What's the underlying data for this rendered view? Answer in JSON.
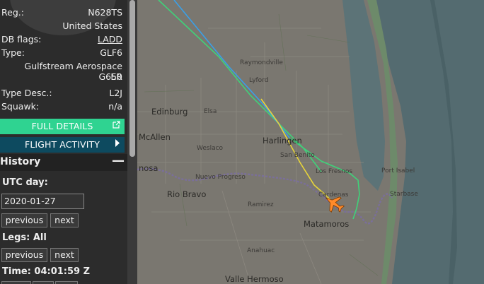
{
  "aircraft": {
    "reg_label": "Reg.:",
    "reg_value": "N628TS",
    "country": "United States",
    "dbflags_label": "DB flags:",
    "dbflags_value": "LADD",
    "type_label": "Type:",
    "type_value": "GLF6",
    "type_name_line1": "Gulfstream Aerospace G650",
    "type_name_line2": "ER",
    "typedesc_label": "Type Desc.:",
    "typedesc_value": "L2J",
    "squawk_label": "Squawk:",
    "squawk_value": "n/a"
  },
  "buttons": {
    "full_details": "FULL DETAILS",
    "flight_activity": "FLIGHT ACTIVITY"
  },
  "history": {
    "title": "History",
    "utc_day_label": "UTC day:",
    "date_value": "2020-01-27",
    "previous_label": "previous",
    "next_label": "next",
    "legs_label": "Legs: All",
    "time_label": "Time: 04:01:59 Z"
  },
  "map": {
    "places": [
      {
        "name": "Raymondville"
      },
      {
        "name": "Lyford"
      },
      {
        "name": "Edinburg"
      },
      {
        "name": "Elsa"
      },
      {
        "name": "McAllen"
      },
      {
        "name": "Weslaco"
      },
      {
        "name": "Harlingen"
      },
      {
        "name": "San Benito"
      },
      {
        "name": "Los Fresnos"
      },
      {
        "name": "Port Isabel"
      },
      {
        "name": "Starbase"
      },
      {
        "name": "nosa"
      },
      {
        "name": "Nuevo Progreso"
      },
      {
        "name": "Rio Bravo"
      },
      {
        "name": "Ramirez"
      },
      {
        "name": "Matamoros"
      },
      {
        "name": "Anahuac"
      },
      {
        "name": "Valle Hermoso"
      },
      {
        "name": "Cardenas"
      }
    ],
    "colors": {
      "land": "#7a7770",
      "water": "#546b70",
      "track_green": "#3fd27a",
      "track_blue": "#3aa0e8",
      "track_yellow": "#e8d53a",
      "aircraft": "#ff8a2a"
    }
  }
}
